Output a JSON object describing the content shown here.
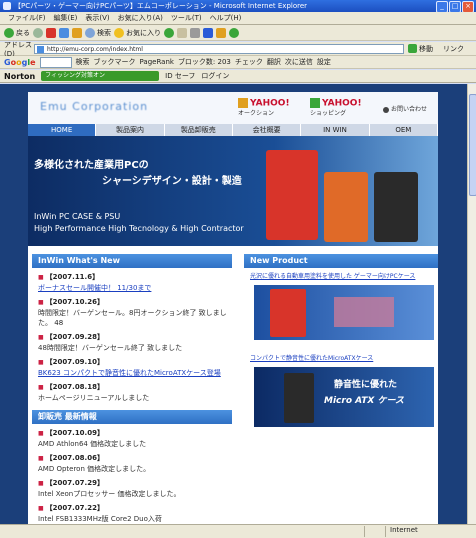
{
  "window": {
    "title": "【PCパーツ・ゲーマー向けPCパーツ】エムコーポレーション - Microsoft Internet Explorer"
  },
  "menu": [
    "ファイル(F)",
    "編集(E)",
    "表示(V)",
    "お気に入り(A)",
    "ツール(T)",
    "ヘルプ(H)"
  ],
  "toolbar": {
    "back": "戻る",
    "search": "検索",
    "favorites": "お気に入り"
  },
  "address": {
    "label": "アドレス(D)",
    "url": "http://emu-corp.com/index.html",
    "go": "移動",
    "links": "リンク"
  },
  "googlebar": {
    "logo": [
      "G",
      "o",
      "o",
      "g",
      "l",
      "e"
    ],
    "search": "検索",
    "bookmarks": "ブックマーク",
    "pagerank": "PageRank",
    "blocked": "ブロック数: 203",
    "check": "チェック",
    "translate": "翻訳",
    "next": "次に送信",
    "settings": "設定"
  },
  "nortonbar": {
    "logo": "Norton",
    "phishing": "フィッシング対策オン",
    "idsafe": "ID セーフ",
    "login": "ログイン"
  },
  "site": {
    "logo": "Emu Corporation",
    "yahoo_auction": {
      "brand": "YAHOO!",
      "label": "オークション"
    },
    "yahoo_shopping": {
      "brand": "YAHOO!",
      "label": "ショッピング"
    },
    "contact": "お問い合わせ",
    "nav": [
      "HOME",
      "製品案内",
      "製品卸販売",
      "会社概要",
      "IN WIN",
      "OEM"
    ],
    "hero": {
      "jp1": "多様化された産業用PCの",
      "jp2": "シャーシデザイン・設計・製造",
      "en1": "InWin PC CASE & PSU",
      "en2": "High Performance High Tecnology & High Contractor"
    },
    "whats_new": {
      "title": "InWin What's New",
      "items": [
        {
          "date": "【2007.11.6】",
          "text": "ボーナスセール開催中！ 11/30まで",
          "link": true
        },
        {
          "date": "【2007.10.26】",
          "text": "時間限定！バーゲンセール。8円オークション終了 致しました。",
          "link": false,
          "extra": "48"
        },
        {
          "date": "【2007.09.28】",
          "text": "48時間限定！バーゲンセール終了 致しました",
          "link": false
        },
        {
          "date": "【2007.09.10】",
          "text": "BK623 コンパクトで静音性に優れたMicroATXケース登場",
          "link": true
        },
        {
          "date": "【2007.08.18】",
          "text": "ホームページリニューアルしました",
          "link": false
        }
      ]
    },
    "wholesale": {
      "title": "卸販売 最新情報",
      "items": [
        {
          "date": "【2007.10.09】",
          "text": "AMD Athlon64 価格改定しました"
        },
        {
          "date": "【2007.08.06】",
          "text": "AMD Opteron 価格改定しました。"
        },
        {
          "date": "【2007.07.29】",
          "text": "Intel Xeonプロセッサー 価格改定しました。"
        },
        {
          "date": "【2007.07.22】",
          "text": "Intel FSB1333MHz版 Core2 Duo入荷"
        }
      ]
    },
    "new_product": {
      "title": "New Product",
      "p1": "光沢に優れる自動車用塗料を使用した ゲーマー向けPCケース",
      "p2": "コンパクトで静音性に優れたMicroATXケース",
      "banner2_line1": "静音性に優れた",
      "banner2_line2": "Micro ATX ケース"
    }
  },
  "status": {
    "zone": "インターネット",
    "zone_en": "Internet"
  },
  "colors": {
    "hero": "#1a4e96",
    "nav_active": "#2f6cc0",
    "page_bg": "#1b3f7a",
    "case_red": "#d8342a",
    "case_orange": "#e06a28",
    "case_black": "#2a2a2a"
  }
}
